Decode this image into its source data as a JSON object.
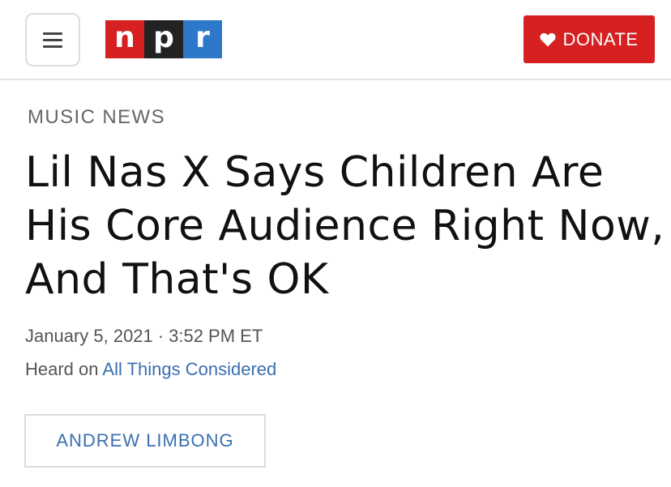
{
  "header": {
    "menu_icon": "hamburger-menu-icon",
    "logo_letters": [
      "n",
      "p",
      "r"
    ],
    "logo_colors": [
      "#d62021",
      "#222222",
      "#2d78c8"
    ],
    "donate": {
      "icon": "heart-icon",
      "label": "DONATE",
      "color": "#d62021"
    }
  },
  "article": {
    "section": "MUSIC NEWS",
    "headline": "Lil Nas X Says Children Are His Core Audience Right Now, And That's OK",
    "date": "January 5, 2021",
    "separator": "·",
    "time": "3:52 PM ET",
    "heard_prefix": "Heard on",
    "show": "All Things Considered",
    "author": "ANDREW LIMBONG",
    "link_color": "#3a6fb0"
  }
}
